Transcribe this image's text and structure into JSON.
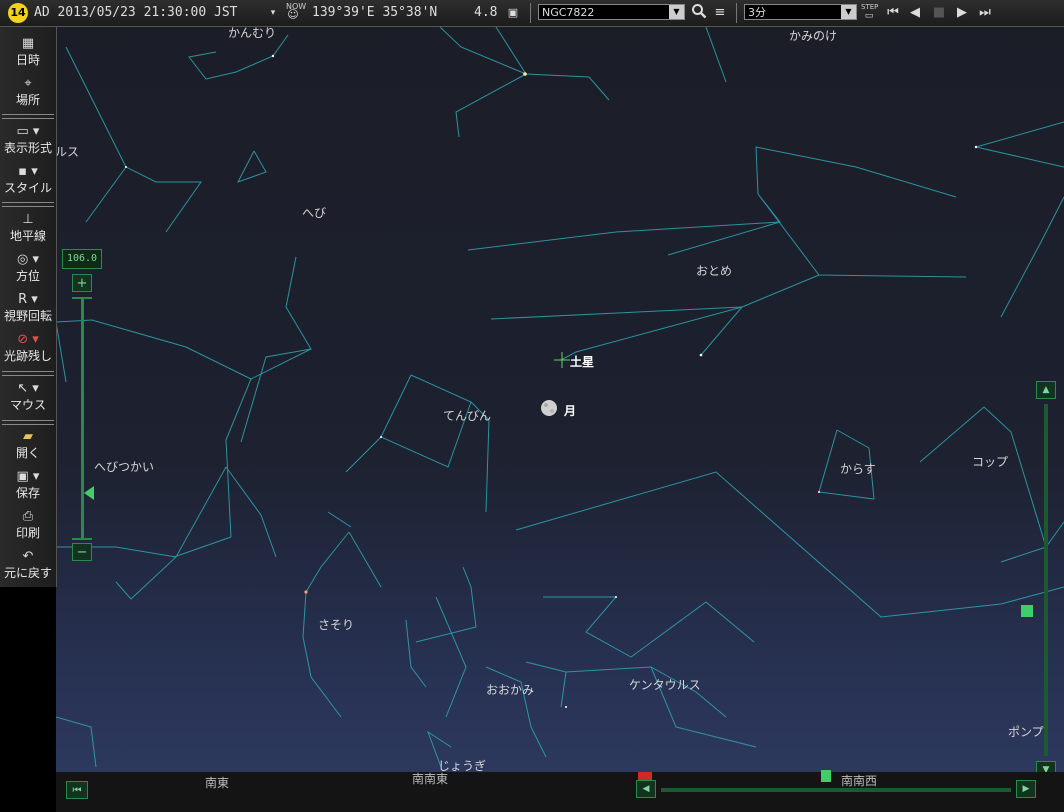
{
  "toolbar": {
    "badge": "14",
    "datetime": "AD 2013/05/23 21:30:00 JST",
    "now_label": "NOW",
    "location": "139°39'E 35°38'N",
    "magnitude": "4.8",
    "search_value": "NGC7822",
    "step_value": "3分",
    "step_label": "STEP"
  },
  "sidebar": {
    "items": [
      {
        "label": "日時"
      },
      {
        "label": "場所"
      },
      {
        "label": "表示形式"
      },
      {
        "label": "スタイル"
      },
      {
        "label": "地平線"
      },
      {
        "label": "方位"
      },
      {
        "label": "視野回転"
      },
      {
        "label": "光跡残し"
      },
      {
        "label": "マウス"
      },
      {
        "label": "開く"
      },
      {
        "label": "保存"
      },
      {
        "label": "印刷"
      },
      {
        "label": "元に戻す"
      }
    ]
  },
  "zoom": {
    "value": "106.0",
    "plus": "+",
    "minus": "−"
  },
  "sky": {
    "constellations": [
      {
        "name": "かんむり"
      },
      {
        "name": "かみのけ"
      },
      {
        "name": "へび"
      },
      {
        "name": "おとめ"
      },
      {
        "name": "てんびん"
      },
      {
        "name": "へびつかい"
      },
      {
        "name": "からす"
      },
      {
        "name": "コップ"
      },
      {
        "name": "さそり"
      },
      {
        "name": "おおかみ"
      },
      {
        "name": "ケンタウルス"
      },
      {
        "name": "じょうぎ"
      },
      {
        "name": "ポンプ"
      },
      {
        "name": "ルス"
      }
    ],
    "objects": [
      {
        "name": "土星"
      },
      {
        "name": "月"
      }
    ]
  },
  "horizon": {
    "directions": [
      "南東",
      "南南東",
      "南南西"
    ]
  },
  "colors": {
    "constellation_line": "#2fa7b3",
    "accent_green": "#2a8a4a",
    "badge": "#f2d21a"
  }
}
